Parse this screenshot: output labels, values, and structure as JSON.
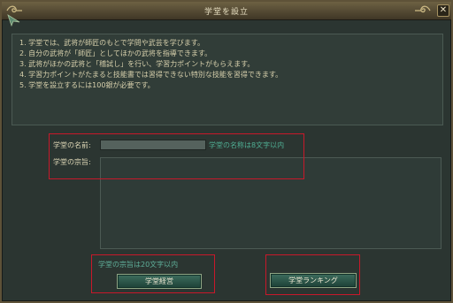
{
  "window": {
    "title": "学堂を設立",
    "close_label": "✕"
  },
  "info": {
    "lines": [
      "1. 学堂では、武将が師匠のもとで学問や武芸を学びます。",
      "2. 自分の武将が「師匠」としてほかの武将を指導できます。",
      "3. 武将がほかの武将と「稽試し」を行い、学習力ポイントがもらえます。",
      "4. 学習力ポイントがたまると技能書では習得できない特別な技能を習得できます。",
      "5. 学堂を設立するには100銀が必要です。"
    ]
  },
  "form": {
    "name_label": "学堂の名前:",
    "name_value": "",
    "name_hint": "学堂の名称は8文字以内",
    "purpose_label": "学堂の宗旨:",
    "purpose_value": "",
    "purpose_hint": "学堂の宗旨は20文字以内"
  },
  "buttons": {
    "manage": "学堂経営",
    "ranking": "学堂ランキング"
  },
  "colors": {
    "highlight": "#c8182a",
    "hint_text": "#4fae93",
    "window_bg": "#2b3531",
    "title_bar": "#5e5238"
  },
  "icons": {
    "corner": "leaf-corner-icon",
    "title_left": "scroll-ornament-icon",
    "title_right": "scroll-ornament-icon",
    "close": "close-icon"
  }
}
